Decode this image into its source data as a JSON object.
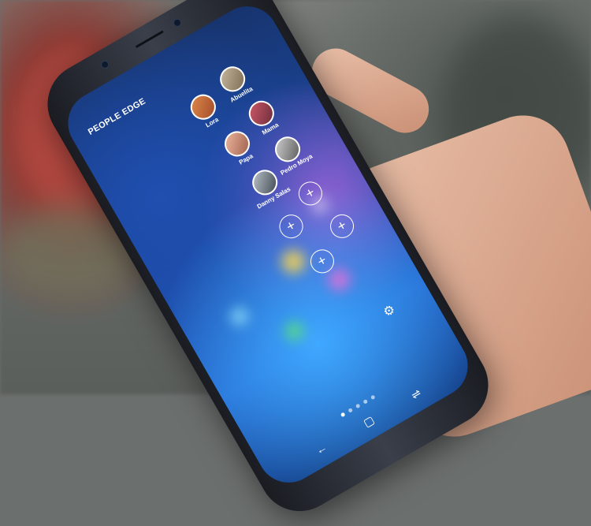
{
  "panel": {
    "title": "PEOPLE EDGE"
  },
  "contacts": [
    {
      "name": "Lora"
    },
    {
      "name": "Abuelita"
    },
    {
      "name": "Mama"
    },
    {
      "name": "Papa"
    },
    {
      "name": "Pedro Moya"
    },
    {
      "name": "Danny Salas"
    }
  ],
  "add_slots": [
    {
      "symbol": "+"
    },
    {
      "symbol": "+"
    },
    {
      "symbol": "+"
    },
    {
      "symbol": "+"
    }
  ],
  "icons": {
    "settings": "gear-icon",
    "back": "back-arrow-icon",
    "home": "square-icon",
    "recents": "recents-icon"
  },
  "colors": {
    "screen_top": "#17346e",
    "screen_mid": "#256ad0",
    "accent_white": "#ffffff"
  },
  "page_indicator": {
    "count": 5,
    "active_index": 0
  }
}
